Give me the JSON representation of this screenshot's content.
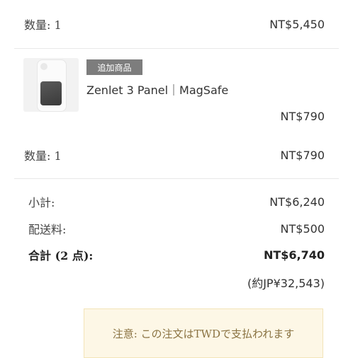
{
  "item1": {
    "qty_label": "数量: 1",
    "price": "NT$5,450"
  },
  "item2": {
    "tag": "追加商品",
    "name": "Zenlet 3 Panel｜MagSafe",
    "unit_price": "NT$790",
    "qty_label": "数量: 1",
    "price": "NT$790"
  },
  "summary": {
    "subtotal_label": "小計:",
    "subtotal_value": "NT$6,240",
    "shipping_label": "配送料:",
    "shipping_value": "NT$500",
    "total_label": "合計 (2 点):",
    "total_value": "NT$6,740",
    "converted": "(約JP¥32,543)"
  },
  "notice": {
    "text": "注意: この注文はTWDで支払われます"
  }
}
